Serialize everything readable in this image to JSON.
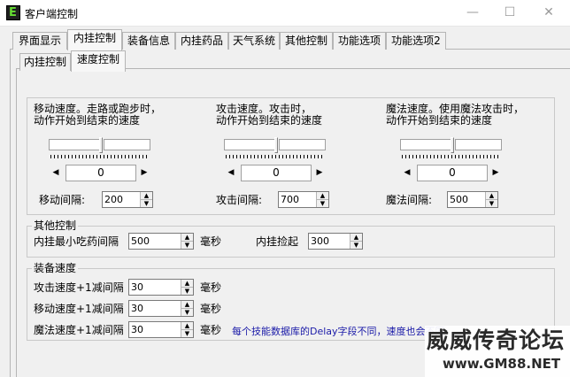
{
  "window": {
    "title": "客户端控制",
    "icon_glyph": "E",
    "minimize_glyph": "—",
    "maximize_glyph": "☐",
    "close_glyph": "✕"
  },
  "top_tabs": [
    "界面显示",
    "内挂控制",
    "装备信息",
    "内挂药品",
    "天气系统",
    "其他控制",
    "功能选项",
    "功能选项2"
  ],
  "active_top_tab": "内挂控制",
  "sub_tabs": [
    "内挂控制",
    "速度控制"
  ],
  "active_sub_tab": "速度控制",
  "speed_controls": [
    {
      "desc_line1": "移动速度。走路或跑步时，",
      "desc_line2": "动作开始到结束的速度",
      "slider_value": "0",
      "interval_label": "移动间隔:",
      "interval_value": "200"
    },
    {
      "desc_line1": "攻击速度。攻击时，",
      "desc_line2": "动作开始到结束的速度",
      "slider_value": "0",
      "interval_label": "攻击间隔:",
      "interval_value": "700"
    },
    {
      "desc_line1": "魔法速度。使用魔法攻击时，",
      "desc_line2": "动作开始到结束的速度",
      "slider_value": "0",
      "interval_label": "魔法间隔:",
      "interval_value": "500"
    }
  ],
  "other_control": {
    "title": "其他控制",
    "potion_label": "内挂最小吃药间隔",
    "potion_value": "500",
    "potion_unit": "毫秒",
    "pickup_label": "内挂捡起",
    "pickup_value": "300"
  },
  "equip_speed": {
    "title": "装备速度",
    "rows": [
      {
        "label": "攻击速度+1减间隔",
        "value": "30",
        "unit": "毫秒"
      },
      {
        "label": "移动速度+1减间隔",
        "value": "30",
        "unit": "毫秒"
      },
      {
        "label": "魔法速度+1减间隔",
        "value": "30",
        "unit": "毫秒"
      }
    ],
    "note": "每个技能数据库的Delay字段不同，速度也会不同"
  },
  "watermark": {
    "line1": "威威传奇论坛",
    "line2": "www.GM88.NET"
  }
}
